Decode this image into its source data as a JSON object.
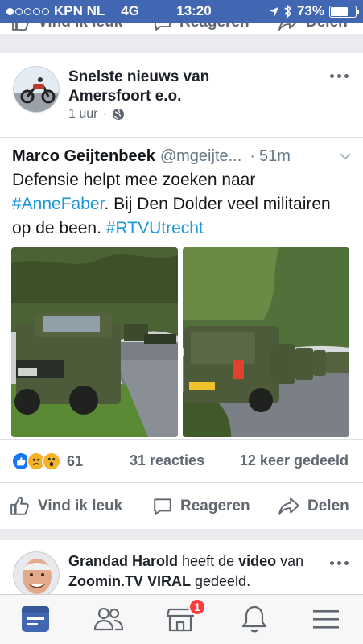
{
  "status_bar": {
    "carrier": "KPN NL",
    "network": "4G",
    "time": "13:20",
    "battery": "73%",
    "battery_level": 0.73,
    "signal_bars_filled": 1,
    "signal_bars_total": 5
  },
  "previous_post_actions": {
    "like_label": "Vind ik leuk",
    "comment_label": "Reageren",
    "share_label": "Delen"
  },
  "post": {
    "page_name": "Snelste nieuws van Amersfoort e.o.",
    "time_ago": "1 uur",
    "privacy_icon": "globe-icon",
    "tweet": {
      "author": "Marco Geijtenbeek",
      "handle": "@mgeijte...",
      "time_sep": "·",
      "time": "51m",
      "text_1": "Defensie helpt mee zoeken naar ",
      "hashtag_1": "#AnneFaber",
      "text_2": ". Bij Den Dolder veel militairen op de been. ",
      "hashtag_2": "#RTVUtrecht"
    },
    "reactions": {
      "types": [
        "like",
        "sad",
        "wow"
      ],
      "count": "61"
    },
    "comments": "31 reacties",
    "shares": "12 keer gedeeld",
    "actions": {
      "like_label": "Vind ik leuk",
      "comment_label": "Reageren",
      "share_label": "Delen"
    }
  },
  "next_post": {
    "actor": "Grandad Harold",
    "verb": " heeft de ",
    "object": "video",
    "prep": " van ",
    "source": "Zoomin.TV VIRAL",
    "suffix": " gedeeld."
  },
  "tabbar": {
    "tabs": [
      "news-feed",
      "friends",
      "marketplace",
      "notifications",
      "menu"
    ],
    "marketplace_badge": "1"
  },
  "colors": {
    "brand": "#4267b2",
    "hashtag": "#1b95e0",
    "badge": "#fa3e3e",
    "active_tab": "#4267b2"
  }
}
